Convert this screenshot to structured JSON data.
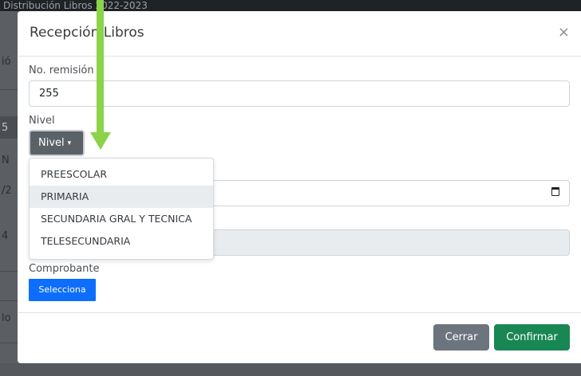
{
  "background": {
    "topbar_text": "Distribución Libros 2022-2023",
    "fragments": [
      "ió",
      "5",
      "N",
      "/2",
      "4",
      "lo"
    ]
  },
  "modal": {
    "title": "Recepción Libros",
    "close_glyph": "×",
    "fields": {
      "remision": {
        "label": "No. remisión",
        "value": "255"
      },
      "nivel": {
        "label": "Nivel",
        "button_label": "Nivel",
        "caret": "▾"
      },
      "date_input": {
        "value": ""
      },
      "disabled_input": {
        "value": ""
      },
      "comprobante": {
        "label": "Comprobante",
        "button_label": "Selecciona"
      }
    },
    "dropdown": {
      "items": [
        "PREESCOLAR",
        "PRIMARIA",
        "SECUNDARIA GRAL Y TECNICA",
        "TELESECUNDARIA"
      ],
      "highlighted": "PRIMARIA"
    },
    "footer": {
      "cancel_label": "Cerrar",
      "confirm_label": "Confirmar"
    }
  },
  "colors": {
    "primary": "#0d6efd",
    "secondary": "#6c757d",
    "success": "#198754",
    "annotation_arrow": "#8bd349"
  }
}
